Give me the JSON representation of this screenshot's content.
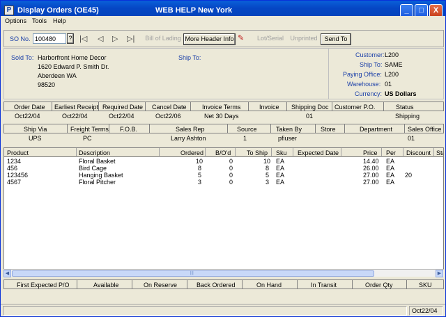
{
  "window": {
    "title_left": "Display Orders (OE45)",
    "title_help": "WEB HELP",
    "title_city": "New York",
    "min": "_",
    "max": "□",
    "close": "X",
    "app_icon": "P"
  },
  "menu": [
    "Options",
    "Tools",
    "Help"
  ],
  "toolbar": {
    "so_label": "SO No.",
    "so_value": "100480",
    "q": "?",
    "bill_of_lading": "Bill of Lading",
    "more_header": "More Header Info",
    "lot_serial": "Lot/Serial",
    "unprinted": "Unprinted",
    "send_to": "Send To",
    "nav_icons": [
      "first-icon",
      "prev-icon",
      "next-icon",
      "last-icon"
    ],
    "nav_glyphs": [
      "|◁",
      "◁",
      "▷",
      "▷|"
    ],
    "edit_glyph": "✎"
  },
  "header": {
    "sold_to_label": "Sold To:",
    "sold_to_lines": [
      "Harborfront Home Decor",
      "1620 Edward P. Smith Dr.",
      "Aberdeen  WA",
      "98520"
    ],
    "ship_to_label": "Ship To:",
    "customer_label": "Customer:",
    "customer": "L200",
    "shipto_label": "Ship To:",
    "shipto": "SAME",
    "paying_label": "Paying Office:",
    "paying": "L200",
    "warehouse_label": "Warehouse:",
    "warehouse": "01",
    "currency_label": "Currency:",
    "currency": "US Dollars"
  },
  "row1": {
    "headers": [
      "Order Date",
      "Earliest Receipt",
      "Required Date",
      "Cancel Date",
      "Invoice Terms",
      "Invoice",
      "Shipping Doc",
      "Customer P.O.",
      "Status"
    ],
    "values": [
      "Oct22/04",
      "Oct22/04",
      "Oct22/04",
      "Oct22/06",
      "Net 30 Days",
      "",
      "01",
      "",
      "Shipping"
    ]
  },
  "row2": {
    "headers": [
      "Ship Via",
      "Freight Terms",
      "F.O.B.",
      "Sales Rep",
      "Source",
      "Taken By",
      "Store",
      "Department",
      "Sales Office"
    ],
    "values": [
      "UPS",
      "PC",
      "",
      "Larry Ashton",
      "1",
      "pfiuser",
      "",
      "",
      "01"
    ]
  },
  "lines": {
    "headers": [
      "Product",
      "Description",
      "Ordered",
      "B/O'd",
      "To Ship",
      "Sku",
      "Expected Date",
      "Price",
      "Per",
      "Discount",
      "Sta"
    ],
    "rows": [
      [
        "1234",
        "Floral Basket",
        "10",
        "0",
        "10",
        "EA",
        "",
        "14.40",
        "EA",
        ""
      ],
      [
        "456",
        "Bird Cage",
        "8",
        "0",
        "8",
        "EA",
        "",
        "26.00",
        "EA",
        ""
      ],
      [
        "123456",
        "Hanging Basket",
        "5",
        "0",
        "5",
        "EA",
        "",
        "27.00",
        "EA",
        "20"
      ],
      [
        "4567",
        "Floral Pitcher",
        "3",
        "0",
        "3",
        "EA",
        "",
        "27.00",
        "EA",
        ""
      ]
    ],
    "scroll_left": "◀",
    "scroll_right": "▶",
    "thumb_grip": "|||"
  },
  "bottom": {
    "headers": [
      "First Expected P/O",
      "Available",
      "On Reserve",
      "Back Ordered",
      "On Hand",
      "In Transit",
      "Order Qty",
      "SKU"
    ]
  },
  "status": {
    "date": "Oct22/04"
  }
}
